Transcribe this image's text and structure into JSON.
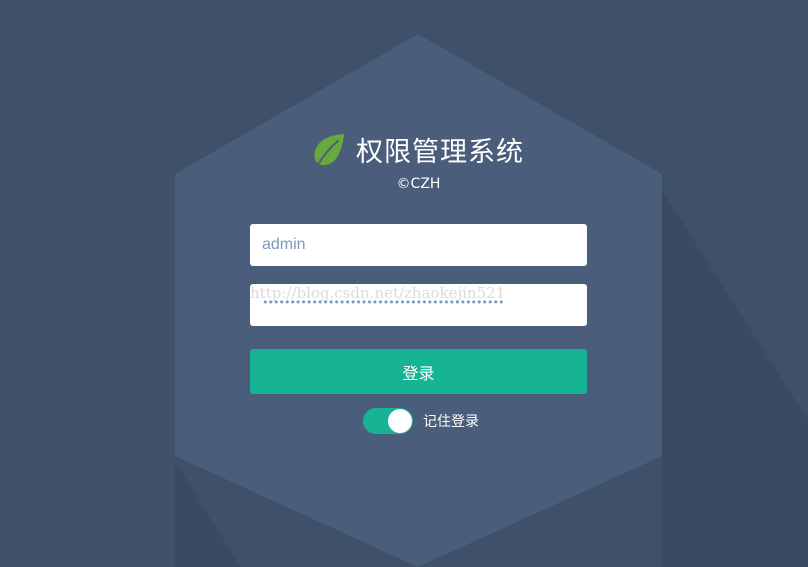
{
  "app": {
    "title": "权限管理系统",
    "copyright": "©CZH",
    "logo_icon": "leaf-icon"
  },
  "login": {
    "username_value": "admin",
    "password_mask": "••••••••••••••••••••••••••••••••••••••••••••",
    "submit_label": "登录",
    "remember_label": "记住登录",
    "remember_checked": true
  },
  "watermark": "http://blog.csdn.net/zhaokejin521",
  "colors": {
    "background": "#3f5069",
    "hexagon": "#4a5d7a",
    "accent": "#17b395",
    "leaf": "#67a83f",
    "input_text": "#7b9abb"
  }
}
